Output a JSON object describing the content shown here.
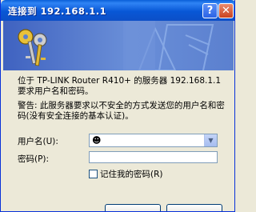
{
  "window": {
    "title": "连接到 192.168.1.1"
  },
  "titlebar": {
    "help_label": "?",
    "close_label": "✕"
  },
  "message": {
    "line1": "位于 TP-LINK Router R410+ 的服务器 192.168.1.1 要求用户名和密码。",
    "warning": "警告: 此服务器要求以不安全的方式发送您的用户名和密码(没有安全连接的基本认证)。"
  },
  "form": {
    "username_label": "用户名(U):",
    "username_value": "",
    "password_label": "密码(P):",
    "password_value": "",
    "remember_label": "记住我的密码(R)",
    "remember_checked": false
  },
  "colors": {
    "titlebar": "#0857d6",
    "banner": "#5b80cf",
    "dialog_bg": "#ece9d8"
  }
}
